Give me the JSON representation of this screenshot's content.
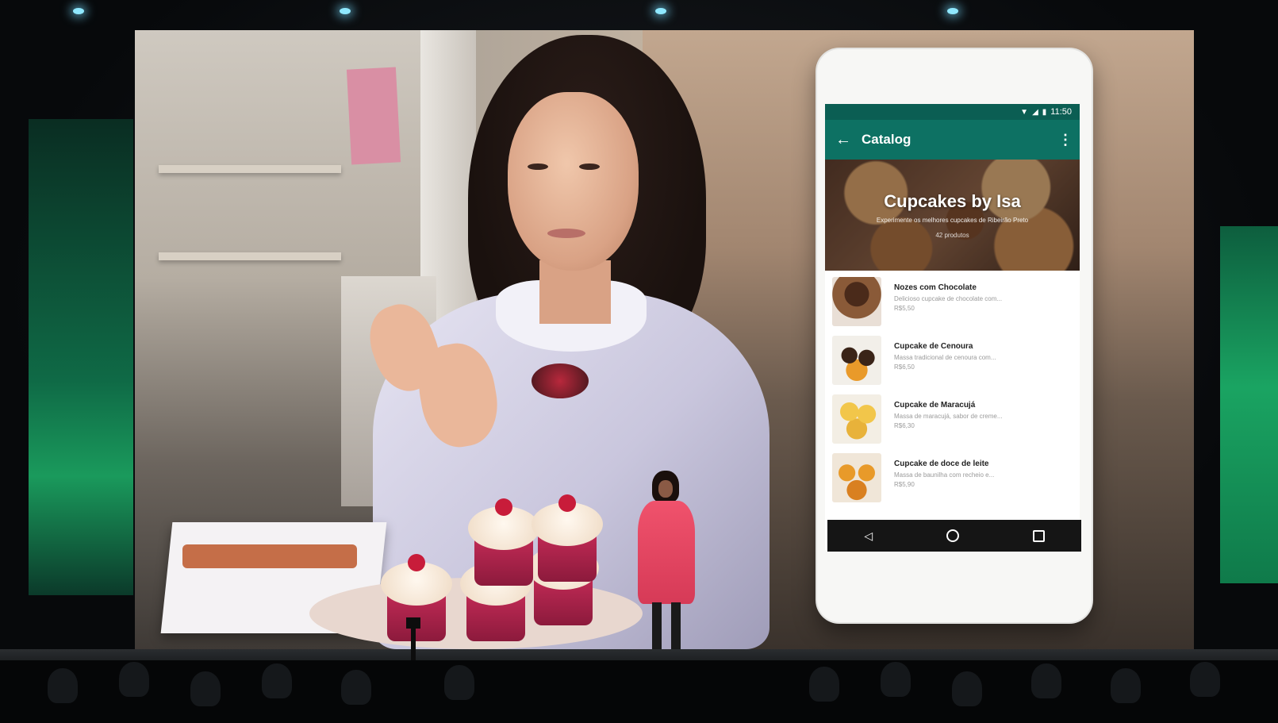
{
  "phone": {
    "status": {
      "time": "11:50",
      "wifi_icon": "wifi-icon",
      "signal_icon": "signal-icon",
      "battery_icon": "battery-icon"
    },
    "app_bar": {
      "title": "Catalog",
      "back_icon": "arrow-back-icon",
      "menu_icon": "more-vert-icon"
    },
    "hero": {
      "title": "Cupcakes by Isa",
      "subtitle": "Experimente os melhores cupcakes de Ribeirão Preto",
      "count": "42 produtos"
    },
    "products": [
      {
        "name": "Nozes com Chocolate",
        "desc": "Delicioso cupcake de chocolate com...",
        "price": "R$5,50"
      },
      {
        "name": "Cupcake de Cenoura",
        "desc": "Massa tradicional de cenoura com...",
        "price": "R$6,50"
      },
      {
        "name": "Cupcake de Maracujá",
        "desc": "Massa de maracujá, sabor de creme...",
        "price": "R$6,30"
      },
      {
        "name": "Cupcake de doce de leite",
        "desc": "Massa de baunilha com recheio e...",
        "price": "R$5,90"
      }
    ],
    "nav": {
      "back_icon": "nav-back-icon",
      "home_icon": "nav-home-icon",
      "recents_icon": "nav-recents-icon"
    }
  },
  "colors": {
    "status_bar": "#0b5e53",
    "app_bar": "#0d7163",
    "side_panel_green": "#1a9a5c",
    "presenter_dress": "#f0526c"
  }
}
